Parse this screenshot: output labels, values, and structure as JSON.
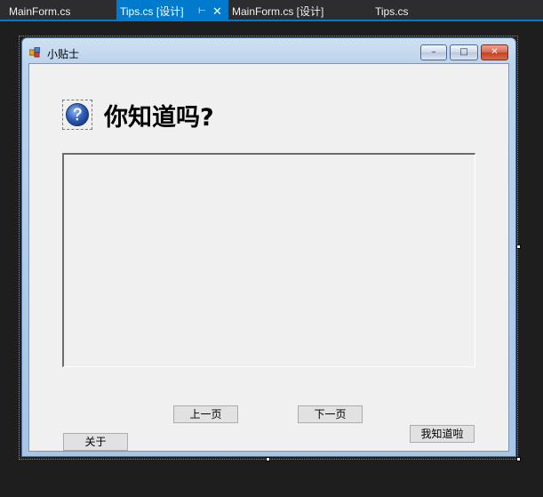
{
  "tabs": [
    {
      "label": "MainForm.cs",
      "active": false
    },
    {
      "label": "Tips.cs [设计]",
      "active": true,
      "pin": "⊢",
      "close": "✕"
    },
    {
      "label": "MainForm.cs [设计]",
      "active": false
    },
    {
      "label": "Tips.cs",
      "active": false
    }
  ],
  "form": {
    "title": "小贴士",
    "heading": "你知道吗?",
    "tip_text": "",
    "buttons": {
      "prev": "上一页",
      "next": "下一页",
      "about": "关于",
      "ok": "我知道啦"
    },
    "caption": {
      "minimize": "–",
      "maximize": "□",
      "close": "✕"
    }
  },
  "icons": {
    "app": "form-app-icon",
    "help": "question-mark-icon"
  },
  "colors": {
    "accent": "#007acc",
    "background": "#1e1e1e",
    "form_client": "#f0f0f0",
    "help_icon": "#2f5fb8"
  }
}
